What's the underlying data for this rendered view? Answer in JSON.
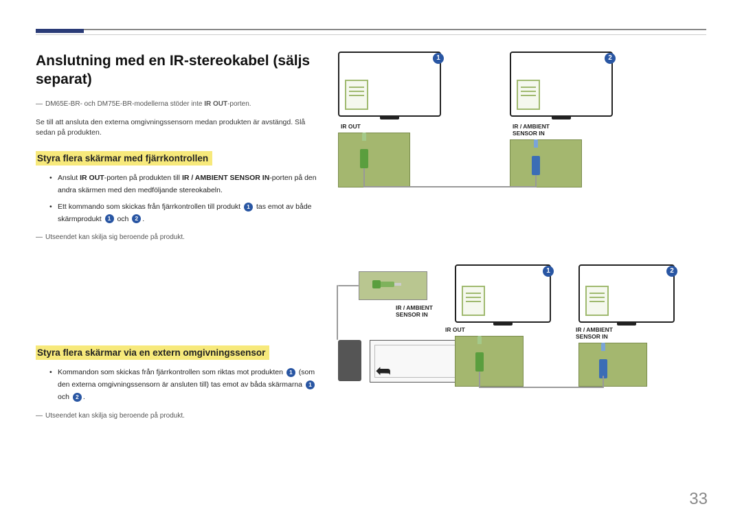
{
  "title": "Anslutning med en IR-stereokabel (säljs separat)",
  "note_model": "DM65E-BR- och DM75E-BR-modellerna stöder inte ",
  "note_model_bold": "IR OUT",
  "note_model_suffix": "-porten.",
  "intro_para": "Se till att ansluta den externa omgivningssensorn medan produkten är avstängd. Slå sedan på produkten.",
  "section1": {
    "heading": "Styra flera skärmar med fjärrkontrollen",
    "bullet1_pre": "Anslut ",
    "bullet1_b1": "IR OUT",
    "bullet1_mid": "-porten på produkten till ",
    "bullet1_b2": "IR / AMBIENT SENSOR IN",
    "bullet1_post": "-porten på den andra skärmen med den medföljande stereokabeln.",
    "bullet2_pre": "Ett kommando som skickas från fjärrkontrollen till produkt ",
    "bullet2_mid": " tas emot av både skärmprodukt ",
    "bullet2_and": " och ",
    "bullet2_end": ".",
    "footnote": "Utseendet kan skilja sig beroende på produkt."
  },
  "section2": {
    "heading": "Styra flera skärmar via en extern omgivningssensor",
    "bullet1_pre": "Kommandon som skickas från fjärrkontrollen som riktas mot produkten ",
    "bullet1_mid": " (som den externa omgivningssensorn är ansluten till) tas emot av båda skärmarna ",
    "bullet1_and": " och ",
    "bullet1_end": ".",
    "footnote": "Utseendet kan skilja sig beroende på produkt."
  },
  "labels": {
    "one": "1",
    "two": "2",
    "ir_out": "IR OUT",
    "ir_ambient": "IR / AMBIENT",
    "sensor_in": "SENSOR IN"
  },
  "page_number": "33"
}
